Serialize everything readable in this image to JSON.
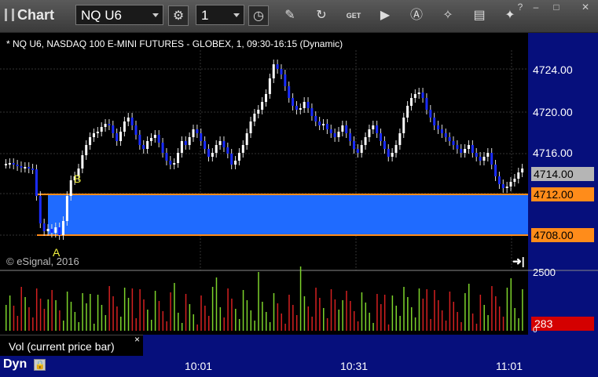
{
  "toolbar": {
    "app_title": "Chart",
    "symbol": "NQ U6",
    "interval": "1",
    "icons": [
      "settings-gear-icon",
      "clock-icon",
      "pencil-draw-icon",
      "refresh-icon",
      "get-data-icon",
      "play-icon",
      "analytics-icon",
      "magic-wand-icon",
      "comment-icon",
      "twitter-icon"
    ]
  },
  "window": {
    "help": "?",
    "minimize": "–",
    "maximize": "□",
    "close": "✕"
  },
  "chart": {
    "description": "* NQ U6, NASDAQ 100 E-MINI FUTURES - GLOBEX, 1, 09:30-16:15 (Dynamic)",
    "copyright": "© eSignal, 2016",
    "label_a": "A",
    "label_b": "B",
    "price_labels": [
      "4724.00",
      "4720.00",
      "4716.00"
    ],
    "current_price": "4714.00",
    "upper_level": "4712.00",
    "lower_level": "4708.00",
    "colors": {
      "zone": "#1f6bff",
      "level_line": "#ff8c1a",
      "price_tag_current": "#b5b5b5",
      "price_tag_level": "#ff8c1a",
      "up_candle": "#ffffff",
      "down_candle": "#1a2cff"
    }
  },
  "volume": {
    "label": "Vol (current price bar)",
    "close_symbol": "×",
    "scale_label": "2500",
    "zero_label": "0",
    "current_volume": "283",
    "colors": {
      "up": "#7dd32b",
      "down": "#d42020",
      "tag": "#d40000"
    }
  },
  "time_axis": {
    "mode": "Dyn",
    "labels": [
      "10:01",
      "10:31",
      "11:01"
    ]
  }
}
